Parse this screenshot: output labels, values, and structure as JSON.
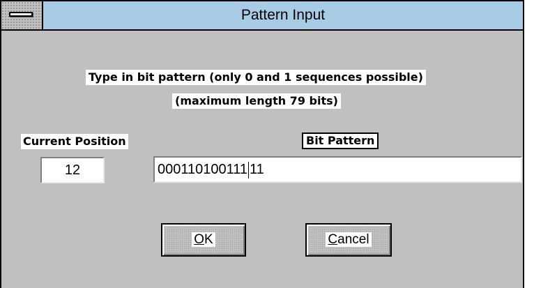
{
  "window": {
    "title": "Pattern Input"
  },
  "instructions": {
    "line1": "Type in bit pattern (only 0 and 1 sequences possible)",
    "line2": "(maximum length 79 bits)"
  },
  "current_position": {
    "label": "Current Position",
    "value": "12"
  },
  "bit_pattern": {
    "label": "Bit Pattern",
    "before_cursor": "000110100111",
    "after_cursor": "11"
  },
  "buttons": {
    "ok": {
      "mnemonic": "O",
      "rest": "K"
    },
    "cancel": {
      "mnemonic": "C",
      "rest": "ancel"
    }
  },
  "colors": {
    "titlebar": "#a8cce6",
    "dialog_background": "#c0c0c0"
  },
  "icons": {
    "system_menu": "system-menu-icon"
  }
}
